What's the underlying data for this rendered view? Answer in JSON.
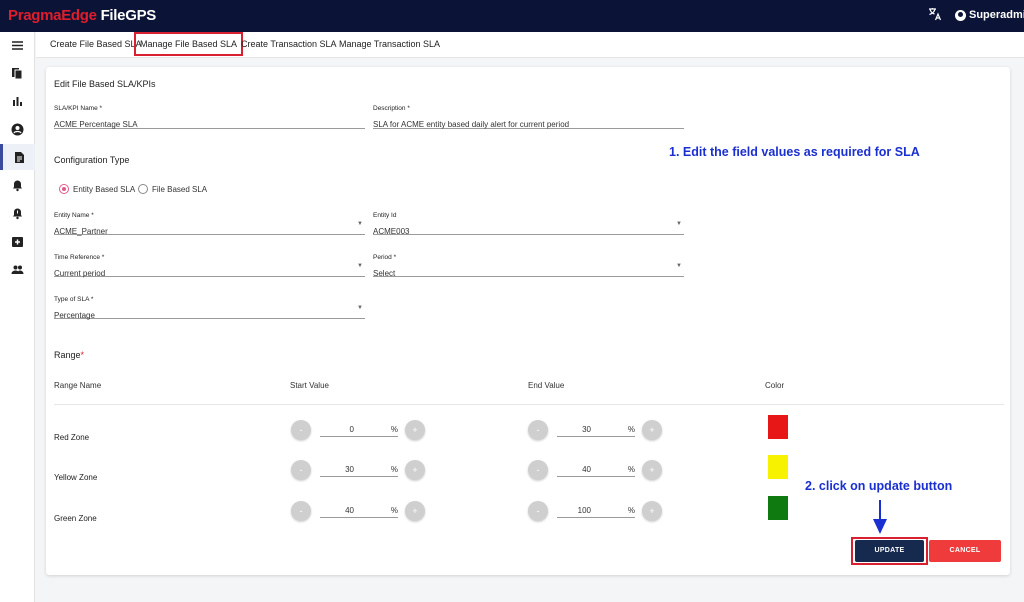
{
  "app": {
    "brand_part1": "PragmaEdge",
    "brand_part2": " FileGPS",
    "user_name": "Superadmin",
    "colors": {
      "topbar": "#0b1437",
      "accent_red": "#d92030",
      "update_btn": "#152a4e",
      "cancel_btn": "#ef3b3b",
      "radio_selected": "#e25a8a",
      "annotation": "#1a2fd1"
    }
  },
  "sidebar": {
    "icons": [
      "menu-icon",
      "file-copy-icon",
      "bar-chart-icon",
      "account-icon",
      "document-icon",
      "bell-icon",
      "bell-alert-icon",
      "first-aid-icon",
      "group-icon"
    ],
    "active_index": 4
  },
  "tabs": [
    {
      "label": "Create File Based SLA",
      "active": false
    },
    {
      "label": "Manage File Based SLA",
      "active": true
    },
    {
      "label": "Create Transaction SLA",
      "active": false
    },
    {
      "label": "Manage Transaction SLA",
      "active": false
    }
  ],
  "form": {
    "title": "Edit File Based SLA/KPIs",
    "sla_name": {
      "label": "SLA/KPI Name *",
      "value": "ACME Percentage SLA"
    },
    "description": {
      "label": "Description *",
      "value": "SLA for ACME entity based daily alert for current period"
    },
    "config_type_label": "Configuration Type",
    "config_options": [
      {
        "label": "Entity Based SLA",
        "selected": true
      },
      {
        "label": "File Based SLA",
        "selected": false
      }
    ],
    "entity_name": {
      "label": "Entity Name *",
      "value": "ACME_Partner"
    },
    "entity_id": {
      "label": "Entity Id",
      "value": "ACME003"
    },
    "time_reference": {
      "label": "Time Reference *",
      "value": "Current period"
    },
    "period": {
      "label": "Period *",
      "value": "Select"
    },
    "type_of_sla": {
      "label": "Type of SLA *",
      "value": "Percentage"
    },
    "range_label": "Range",
    "range_required_mark": "*",
    "range_headers": {
      "name": "Range Name",
      "start": "Start Value",
      "end": "End Value",
      "color": "Color"
    },
    "ranges": [
      {
        "name": "Red Zone",
        "start": "0",
        "end": "30",
        "color": "#e81717"
      },
      {
        "name": "Yellow Zone",
        "start": "30",
        "end": "40",
        "color": "#f7f300"
      },
      {
        "name": "Green Zone",
        "start": "40",
        "end": "100",
        "color": "#0f7a0f"
      }
    ],
    "percent_symbol": "%",
    "minus_symbol": "-",
    "plus_symbol": "+",
    "update_label": "UPDATE",
    "cancel_label": "CANCEL"
  },
  "annotations": {
    "step1": "1. Edit the field values as required for SLA",
    "step2": "2. click on update button"
  }
}
